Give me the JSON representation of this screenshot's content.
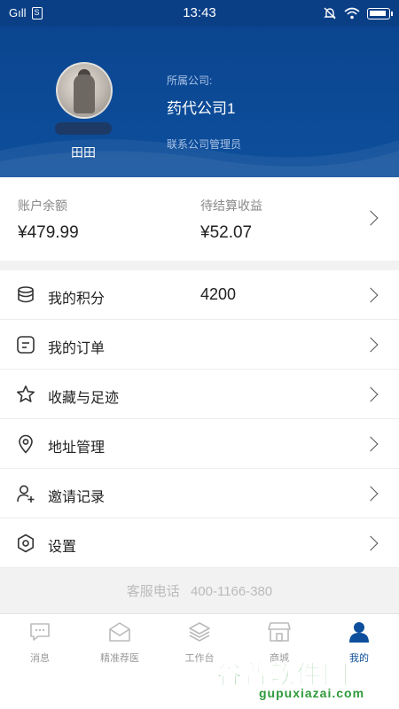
{
  "status": {
    "carrier": "Gıll",
    "sim": "S",
    "time": "13:43"
  },
  "profile": {
    "name": "田田",
    "company_label": "所属公司:",
    "company_name": "药代公司1",
    "role": "联系公司管理员"
  },
  "balance": {
    "account_label": "账户余额",
    "account_value": "¥479.99",
    "pending_label": "待结算收益",
    "pending_value": "¥52.07"
  },
  "menu": [
    {
      "label": "我的积分",
      "value": "4200",
      "icon": "coins-stack-icon"
    },
    {
      "label": "我的订单",
      "icon": "order-document-icon"
    },
    {
      "label": "收藏与足迹",
      "icon": "star-icon"
    },
    {
      "label": "地址管理",
      "icon": "location-pin-icon"
    },
    {
      "label": "邀请记录",
      "icon": "add-user-icon"
    },
    {
      "label": "设置",
      "icon": "hexagon-settings-icon"
    }
  ],
  "service": {
    "label": "客服电话",
    "phone": "400-1166-380"
  },
  "tabs": [
    {
      "label": "消息",
      "icon": "message-icon"
    },
    {
      "label": "精准荐医",
      "icon": "mail-open-icon"
    },
    {
      "label": "工作台",
      "icon": "layers-icon"
    },
    {
      "label": "商城",
      "icon": "store-icon"
    },
    {
      "label": "我的",
      "icon": "person-icon",
      "active": true
    }
  ],
  "watermark": {
    "main": "谷普软件园",
    "sub": "gupuxiazai.com"
  },
  "colors": {
    "primary": "#0d4f9c",
    "watermark": "#2e9a3a"
  }
}
